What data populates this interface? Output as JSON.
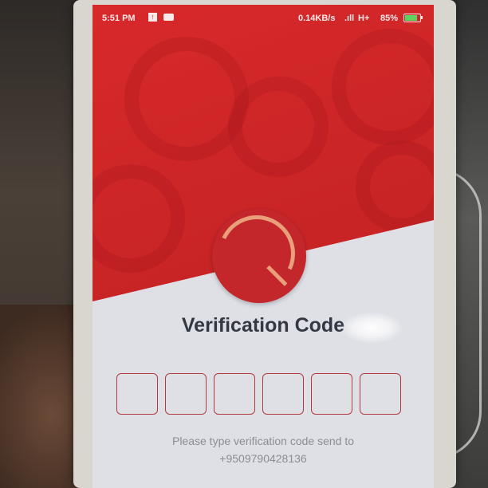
{
  "status_bar": {
    "time": "5:51 PM",
    "speed": "0.14KB/s",
    "signal": ".ıll",
    "network": "H+",
    "battery": "85%",
    "battery_level": 0.85
  },
  "page": {
    "title": "Verification Code",
    "code_box_count": 6,
    "hint_line1": "Please type verification code send to",
    "hint_line2": "+9509790428136"
  },
  "colors": {
    "brand_red": "#d32a2c",
    "box_border": "#b33b3e",
    "title_text": "#333842"
  },
  "icons": [
    "upload-icon",
    "message-icon",
    "battery-icon",
    "app-logo-icon"
  ]
}
